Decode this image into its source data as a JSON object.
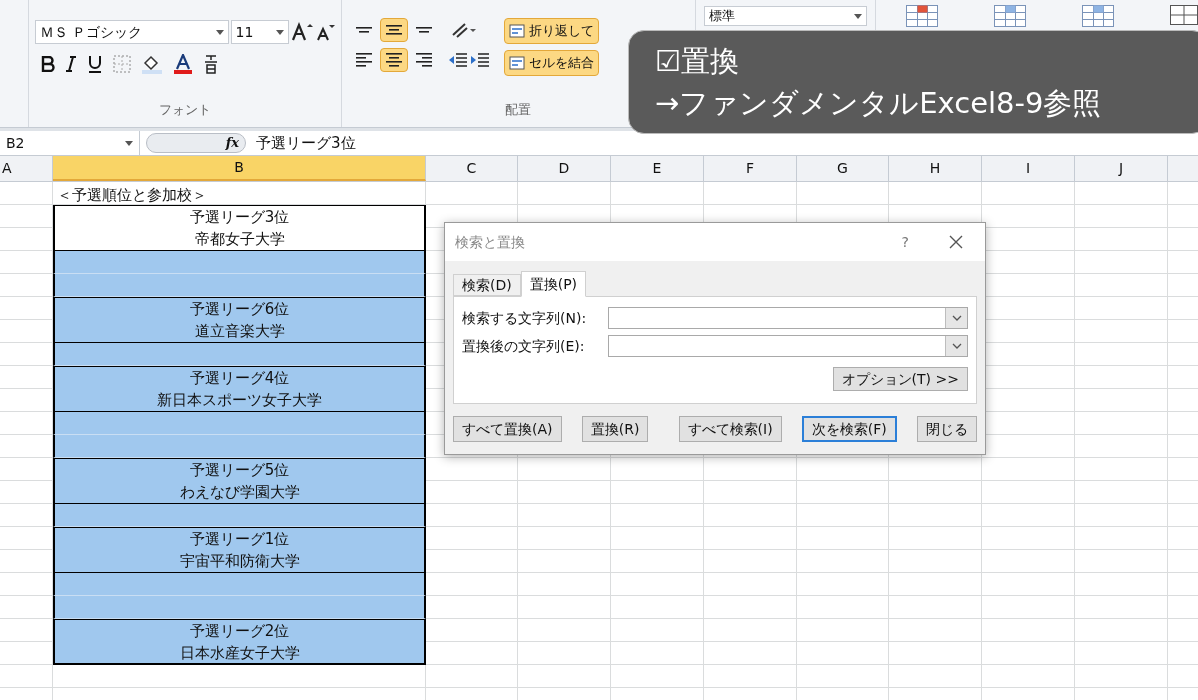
{
  "ribbon": {
    "font_group": {
      "label": "フォント",
      "font_name": "ＭＳ Ｐゴシック",
      "font_size": "11"
    },
    "alignment_group": {
      "label": "配置",
      "vertical": [
        {
          "selected": false
        },
        {
          "selected": true
        },
        {
          "selected": false
        }
      ],
      "horizontal": [
        {
          "selected": false
        },
        {
          "selected": true
        },
        {
          "selected": false
        }
      ],
      "wrap_text": {
        "label": "折り返して",
        "on": true
      },
      "merge": {
        "label": "セルを結合",
        "on": true
      }
    },
    "number_group": {
      "format": "標準"
    }
  },
  "formula_bar": {
    "name_box": "B2",
    "function_label": "fx",
    "content": "予選リーグ3位"
  },
  "columns": [
    {
      "label": "A",
      "selected": false
    },
    {
      "label": "B",
      "selected": true
    },
    {
      "label": "C",
      "selected": false
    },
    {
      "label": "D",
      "selected": false
    },
    {
      "label": "E",
      "selected": false
    },
    {
      "label": "F",
      "selected": false
    },
    {
      "label": "G",
      "selected": false
    },
    {
      "label": "H",
      "selected": false
    },
    {
      "label": "I",
      "selected": false
    },
    {
      "label": "J",
      "selected": false
    }
  ],
  "column_b": [
    {
      "kind": "title",
      "text": "＜予選順位と参加校＞"
    },
    {
      "kind": "entry",
      "lines": [
        "予選リーグ3位",
        "帝都女子大学"
      ],
      "selected": false
    },
    {
      "kind": "blank",
      "selected": true
    },
    {
      "kind": "blank",
      "selected": true
    },
    {
      "kind": "entry",
      "lines": [
        "予選リーグ6位",
        "道立音楽大学"
      ],
      "selected": true
    },
    {
      "kind": "blank",
      "selected": true
    },
    {
      "kind": "entry",
      "lines": [
        "予選リーグ4位",
        "新日本スポーツ女子大学"
      ],
      "selected": true
    },
    {
      "kind": "blank",
      "selected": true
    },
    {
      "kind": "blank",
      "selected": true
    },
    {
      "kind": "entry",
      "lines": [
        "予選リーグ5位",
        "わえなび学園大学"
      ],
      "selected": true
    },
    {
      "kind": "blank",
      "selected": true
    },
    {
      "kind": "entry",
      "lines": [
        "予選リーグ1位",
        "宇宙平和防衛大学"
      ],
      "selected": true
    },
    {
      "kind": "blank",
      "selected": true
    },
    {
      "kind": "blank",
      "selected": true
    },
    {
      "kind": "entry",
      "lines": [
        "予選リーグ2位",
        "日本水産女子大学"
      ],
      "selected": true
    }
  ],
  "dialog": {
    "title": "検索と置換",
    "help": "?",
    "tabs": [
      {
        "label": "検索(D)",
        "selected": false
      },
      {
        "label": "置換(P)",
        "selected": true
      }
    ],
    "fields": [
      {
        "label": "検索する文字列(N):"
      },
      {
        "label": "置換後の文字列(E):"
      }
    ],
    "options_button": "オプション(T) >>",
    "buttons": [
      {
        "label": "すべて置換(A)",
        "default": false
      },
      {
        "label": "置換(R)",
        "default": false
      },
      {
        "label": "すべて検索(I)",
        "default": false
      },
      {
        "label": "次を検索(F)",
        "default": true
      },
      {
        "label": "閉じる",
        "default": false
      }
    ]
  },
  "caption": {
    "lines": [
      "☑置換",
      "→ファンダメンタルExcel8-9参照"
    ]
  }
}
